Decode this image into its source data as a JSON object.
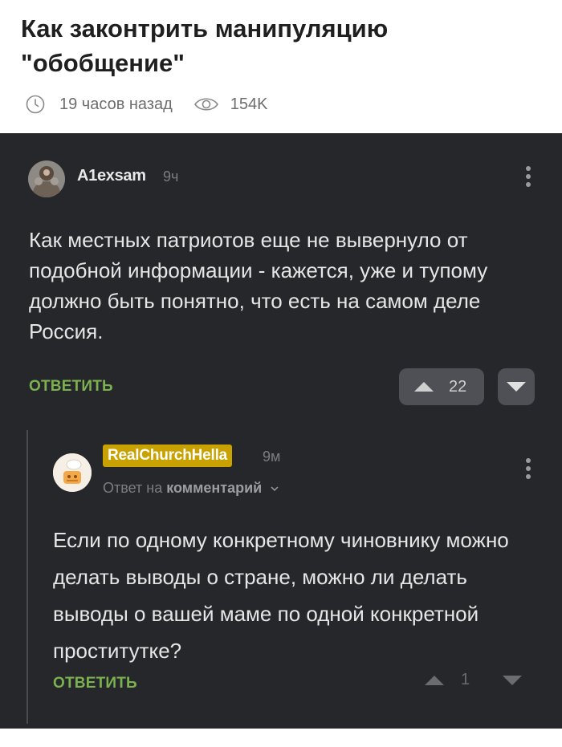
{
  "post": {
    "title": "Как законтрить манипуляцию \"обобщение\"",
    "time_ago": "19 часов назад",
    "views": "154K",
    "icons": [
      "clock-icon",
      "eye-icon"
    ]
  },
  "comments": [
    {
      "username": "A1exsam",
      "time": "9ч",
      "text": "Как местных патриотов еще не вывернуло от подобной информации - кажется, уже и тупому должно быть понятно, что есть на самом деле Россия.",
      "reply_label": "ОТВЕТИТЬ",
      "votes": "22"
    },
    {
      "username": "RealChurchHella",
      "time": "9м",
      "reply_to_prefix": "Ответ на",
      "reply_to_target": "комментарий",
      "text": "Если по одному конкретному чиновнику можно делать выводы о стране, можно ли делать выводы о вашей маме по одной конкретной проститутке?",
      "reply_label": "ОТВЕТИТЬ",
      "votes": "1"
    }
  ],
  "colors": {
    "thread_bg": "#26272b",
    "reply_green": "#7bb14f",
    "username_badge": "#c9a200",
    "vote_button_bg": "#4f5055"
  }
}
